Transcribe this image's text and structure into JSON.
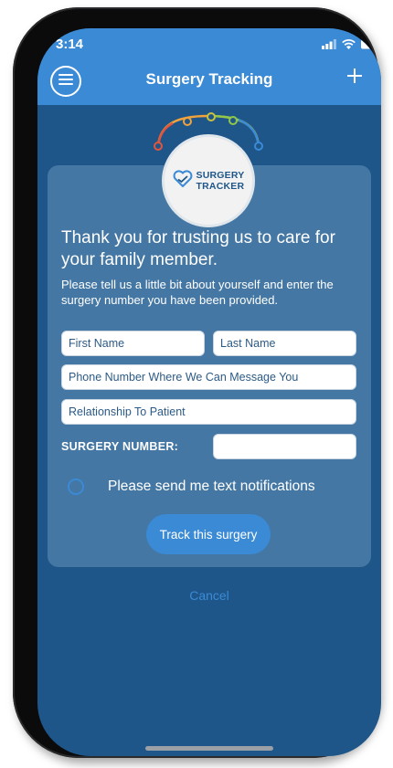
{
  "status_bar": {
    "time": "3:14"
  },
  "nav": {
    "title": "Surgery Tracking"
  },
  "logo": {
    "line1": "SURGERY",
    "line2": "TRACKER"
  },
  "form": {
    "heading": "Thank you for trusting us to care for your family member.",
    "subtext": "Please tell us a little bit about yourself and enter the surgery number you have been provided.",
    "first_name_placeholder": "First Name",
    "last_name_placeholder": "Last Name",
    "phone_placeholder": "Phone Number Where We Can Message You",
    "relationship_placeholder": "Relationship To Patient",
    "surgery_number_label": "SURGERY NUMBER:",
    "surgery_number_value": "",
    "notify_label": "Please send me text notifications",
    "notify_checked": false,
    "submit_label": "Track this surgery"
  },
  "cancel_label": "Cancel",
  "colors": {
    "accent": "#3a8ad6",
    "background": "#1f5689",
    "card": "#4477a3"
  }
}
